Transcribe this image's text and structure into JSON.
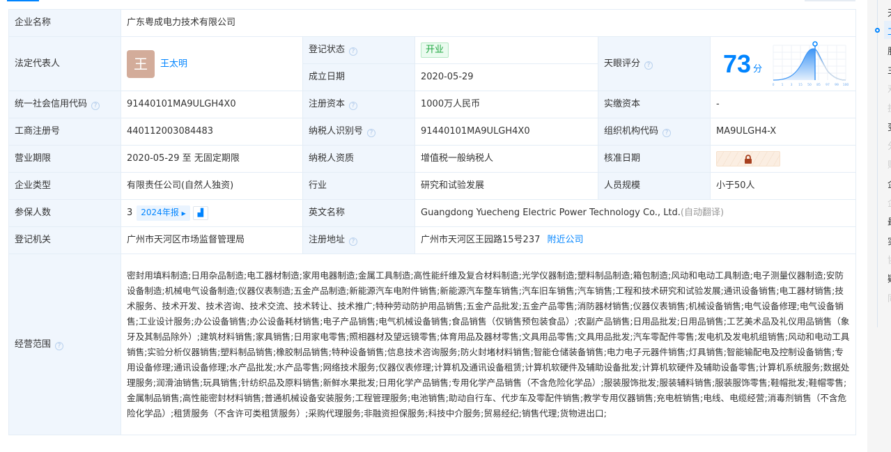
{
  "company_name": {
    "label": "企业名称",
    "value": "广东粤成电力技术有限公司"
  },
  "legal_rep": {
    "label": "法定代表人",
    "avatar_char": "王",
    "name": "王太明"
  },
  "reg_status": {
    "label": "登记状态",
    "value": "开业"
  },
  "found_date": {
    "label": "成立日期",
    "value": "2020-05-29"
  },
  "tianyan_score": {
    "label": "天眼评分",
    "score": "73",
    "unit": "分",
    "axis": [
      "0",
      "1",
      "3",
      "15",
      "50",
      "85",
      "97",
      "99",
      "100"
    ],
    "accent": "#0084ff"
  },
  "credit_code": {
    "label": "统一社会信用代码",
    "value": "91440101MA9ULGH4X0"
  },
  "reg_capital": {
    "label": "注册资本",
    "value": "1000万人民币"
  },
  "paid_capital": {
    "label": "实缴资本",
    "value": "-"
  },
  "biz_reg_no": {
    "label": "工商注册号",
    "value": "440112003084483"
  },
  "taxpayer_id": {
    "label": "纳税人识别号",
    "value": "91440101MA9ULGH4X0"
  },
  "org_code": {
    "label": "组织机构代码",
    "value": "MA9ULGH4-X"
  },
  "term": {
    "label": "营业期限",
    "value": "2020-05-29 至 无固定期限"
  },
  "taxpayer_qual": {
    "label": "纳税人资质",
    "value": "增值税一般纳税人"
  },
  "approve_date": {
    "label": "核准日期",
    "icon": "lock-icon"
  },
  "company_type": {
    "label": "企业类型",
    "value": "有限责任公司(自然人独资)"
  },
  "industry": {
    "label": "行业",
    "value": "研究和试验发展"
  },
  "staff_size": {
    "label": "人员规模",
    "value": "小于50人"
  },
  "insured": {
    "label": "参保人数",
    "value": "3",
    "report": "2024年报"
  },
  "english_name": {
    "label": "英文名称",
    "value": "Guangdong Yuecheng Electric Power Technology Co., Ltd.",
    "translate": "(自动翻译)"
  },
  "reg_authority": {
    "label": "登记机关",
    "value": "广州市天河区市场监督管理局"
  },
  "reg_address": {
    "label": "注册地址",
    "value": "广州市天河区王园路15号237",
    "nearby": "附近公司"
  },
  "scope": {
    "label": "经营范围",
    "value": "密封用填料制造;日用杂品制造;电工器材制造;家用电器制造;金属工具制造;高性能纤维及复合材料制造;光学仪器制造;塑料制品制造;箱包制造;风动和电动工具制造;电子测量仪器制造;安防设备制造;机械电气设备制造;仪器仪表制造;五金产品制造;新能源汽车电附件销售;新能源汽车整车销售;汽车旧车销售;汽车销售;工程和技术研究和试验发展;通讯设备销售;电工器材销售;技术服务、技术开发、技术咨询、技术交流、技术转让、技术推广;特种劳动防护用品销售;五金产品批发;五金产品零售;消防器材销售;仪器仪表销售;机械设备销售;电气设备修理;电气设备销售;工业设计服务;办公设备销售;办公设备耗材销售;电子产品销售;电气机械设备销售;食品销售（仅销售预包装食品）;农副产品销售;日用品批发;日用品销售;工艺美术品及礼仪用品销售（象牙及其制品除外）;建筑材料销售;家具销售;日用家电零售;照相器材及望远镜零售;体育用品及器材零售;文具用品零售;文具用品批发;汽车零配件零售;发电机及发电机组销售;风动和电动工具销售;实验分析仪器销售;塑料制品销售;橡胶制品销售;特种设备销售;信息技术咨询服务;防火封堵材料销售;智能仓储装备销售;电力电子元器件销售;灯具销售;智能输配电及控制设备销售;专用设备修理;通讯设备修理;水产品批发;水产品零售;网络技术服务;仪器仪表修理;计算机及通讯设备租赁;计算机软硬件及辅助设备批发;计算机软硬件及辅助设备零售;计算机系统服务;数据处理服务;润滑油销售;玩具销售;针纺织品及原料销售;新鲜水果批发;日用化学产品销售;专用化学产品销售（不含危险化学品）;服装服饰批发;服装辅料销售;服装服饰零售;鞋帽批发;鞋帽零售;金属制品销售;高性能密封材料销售;普通机械设备安装服务;工程管理服务;电池销售;助动自行车、代步车及零配件销售;教学专用仪器销售;充电桩销售;电线、电缆经营;消毒剂销售（不含危险化学品）;租赁服务（不含许可类租赁服务）;采购代理服务;非融资担保服务;科技中介服务;贸易经纪;销售代理;货物进出口;"
  },
  "side_nav": [
    "天",
    "工",
    "股",
    "主",
    "对",
    "投",
    "变",
    "分",
    "财",
    "企",
    "企",
    "最",
    "实",
    "协",
    "疑",
    "同"
  ]
}
